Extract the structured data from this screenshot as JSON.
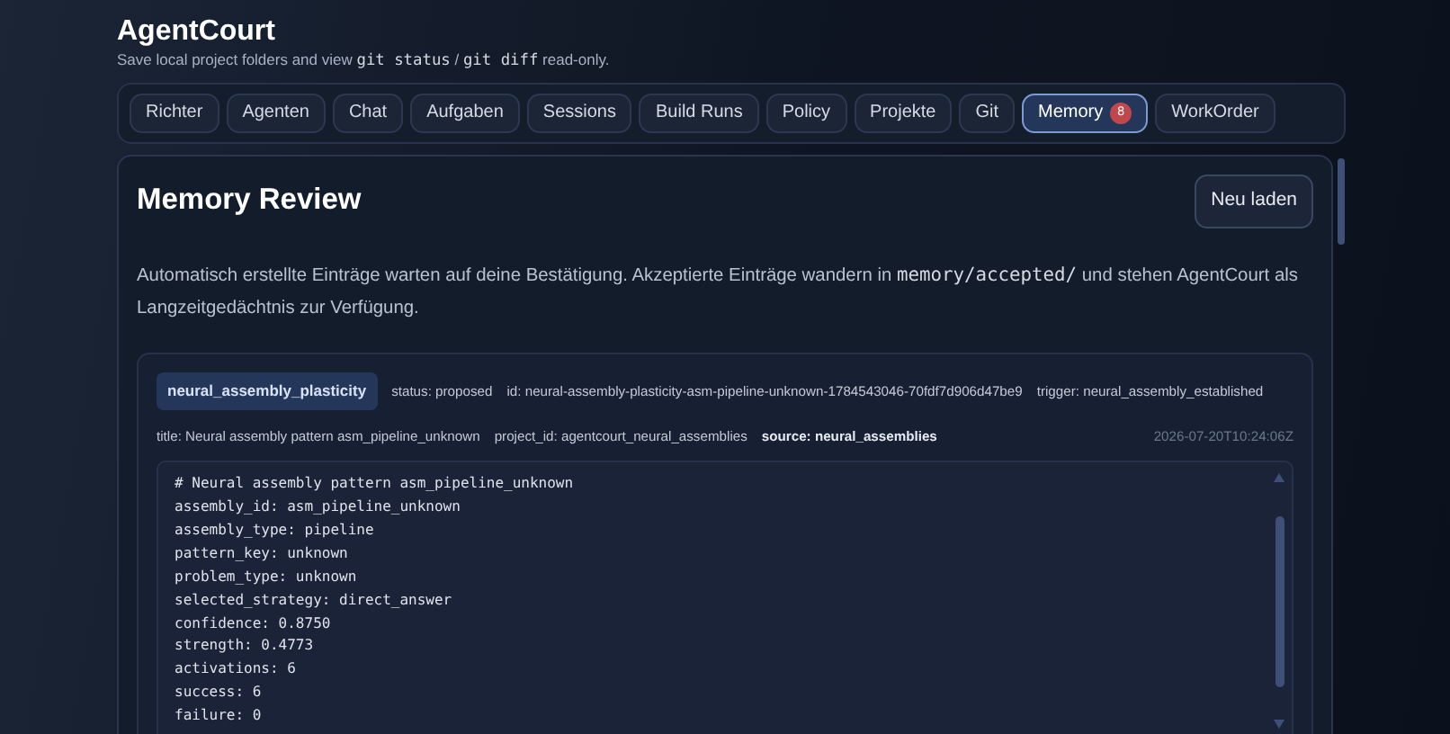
{
  "app": {
    "title": "AgentCourt",
    "subtitle": [
      {
        "kind": "text",
        "text": "Save local project folders and view"
      },
      {
        "kind": "code",
        "text": "git status"
      },
      {
        "kind": "text",
        "text": "/"
      },
      {
        "kind": "code",
        "text": "git diff"
      },
      {
        "kind": "text",
        "text": "read-only."
      }
    ]
  },
  "tabs": [
    {
      "label": "Richter",
      "selected": false
    },
    {
      "label": "Agenten",
      "selected": false
    },
    {
      "label": "Chat",
      "selected": false
    },
    {
      "label": "Aufgaben",
      "selected": false
    },
    {
      "label": "Sessions",
      "selected": false
    },
    {
      "label": "Build Runs",
      "selected": false
    },
    {
      "label": "Policy",
      "selected": false
    },
    {
      "label": "Projekte",
      "selected": false
    },
    {
      "label": "Git",
      "selected": false
    },
    {
      "label": "Memory",
      "selected": true,
      "badge": "8"
    },
    {
      "label": "WorkOrder",
      "selected": false
    }
  ],
  "panel": {
    "title": "Memory Review",
    "reload_button": "Neu laden",
    "intro": [
      {
        "kind": "text",
        "text": "Automatisch erstellte Einträge warten auf deine Bestätigung. Akzeptierte Einträge wandern in"
      },
      {
        "kind": "code",
        "text": "memory/accepted/"
      },
      {
        "kind": "text",
        "text": "und stehen AgentCourt als Langzeitgedächtnis zur Verfügung."
      }
    ]
  },
  "entries": [
    {
      "tag": "neural_assembly_plasticity",
      "status": "status: proposed",
      "id": "id: neural-assembly-plasticity-asm-pipeline-unknown-1784543046-70fdf7d906d47be9",
      "trigger": "trigger: neural_assembly_established",
      "title": "title: Neural assembly pattern asm_pipeline_unknown",
      "project_id": "project_id: agentcourt_neural_assemblies",
      "source": "source: neural_assemblies",
      "timestamp": "2026-07-20T10:24:06Z",
      "content": "# Neural assembly pattern asm_pipeline_unknown\nassembly_id: asm_pipeline_unknown\nassembly_type: pipeline\npattern_key: unknown\nproblem_type: unknown\nselected_strategy: direct_answer\nconfidence: 0.8750\nstrength: 0.4773\nactivations: 6\nsuccess: 6\nfailure: 0"
    }
  ]
}
